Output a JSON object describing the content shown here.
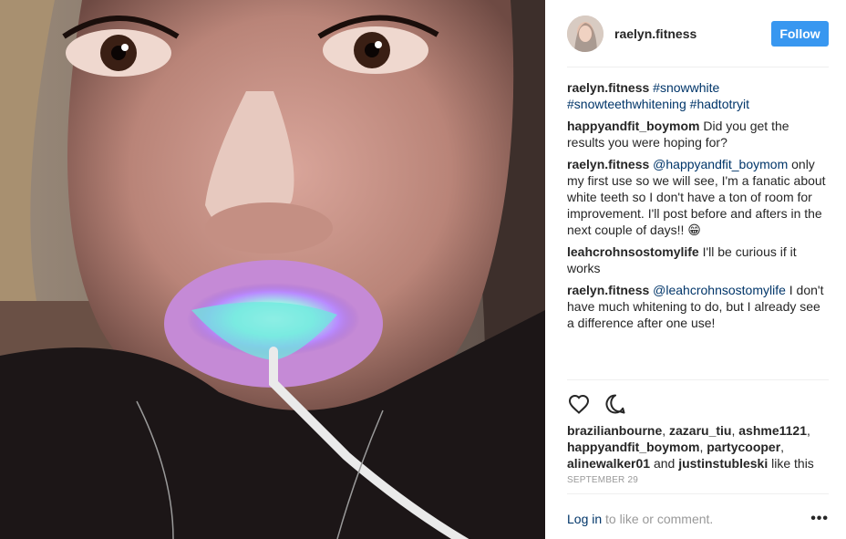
{
  "header": {
    "username": "raelyn.fitness",
    "follow_label": "Follow"
  },
  "comments": [
    {
      "user": "raelyn.fitness",
      "parts": [
        {
          "text": "#snowwhite",
          "tag": true
        },
        {
          "text": " ",
          "tag": false
        },
        {
          "text": "#snowteethwhitening",
          "tag": true
        },
        {
          "text": " ",
          "tag": false
        },
        {
          "text": "#hadtotryit",
          "tag": true
        }
      ]
    },
    {
      "user": "happyandfit_boymom",
      "parts": [
        {
          "text": "Did you get the results you were hoping for?",
          "tag": false
        }
      ]
    },
    {
      "user": "raelyn.fitness",
      "parts": [
        {
          "text": "@happyandfit_boymom",
          "tag": true
        },
        {
          "text": " only my first use so we will see, I'm a fanatic about white teeth so I don't have a ton of room for improvement. I'll post before and afters in the next couple of days!! 😁",
          "tag": false
        }
      ]
    },
    {
      "user": "leahcrohnsostomylife",
      "parts": [
        {
          "text": "I'll be curious if it works",
          "tag": false
        }
      ]
    },
    {
      "user": "raelyn.fitness",
      "parts": [
        {
          "text": "@leahcrohnsostomylife",
          "tag": true
        },
        {
          "text": " I don't have much whitening to do, but I already see a difference after one use!",
          "tag": false
        }
      ]
    }
  ],
  "actions": {
    "like_icon": "heart-icon",
    "comment_icon": "comment-icon"
  },
  "likes": {
    "users": [
      "brazilianbourne",
      "zazaru_tiu",
      "ashme1121",
      "happyandfit_boymom",
      "partycooper",
      "alinewalker01",
      "justinstubleski"
    ],
    "suffix": "like this",
    "and_word": "and"
  },
  "date": "SEPTEMBER 29",
  "footer": {
    "login_label": "Log in",
    "rest_label": "to like or comment.",
    "more_label": "•••"
  }
}
